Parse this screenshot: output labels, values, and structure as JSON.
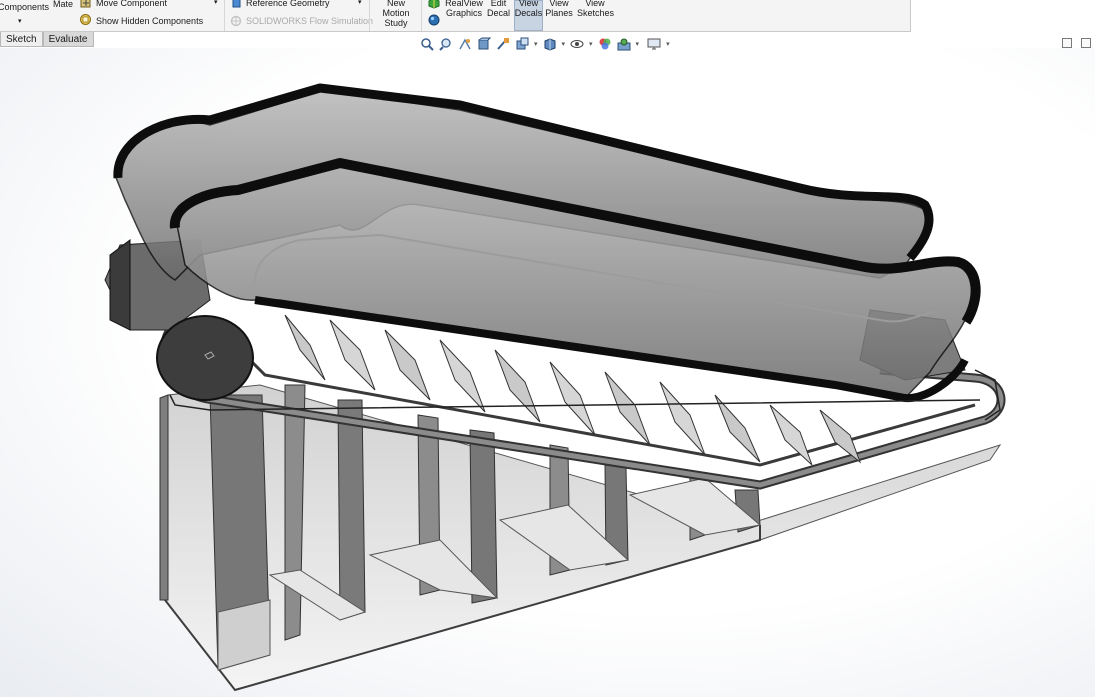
{
  "ribbon": {
    "insert_components_label": "Components",
    "mate_label": "Mate",
    "move_component_label": "Move Component",
    "show_hidden_label": "Show Hidden Components",
    "reference_geometry_label": "Reference Geometry",
    "flow_simulation_label": "SOLIDWORKS Flow Simulation",
    "new_motion_study_label": [
      "New",
      "Motion",
      "Study"
    ],
    "realview_label": [
      "RealView",
      "Graphics"
    ],
    "edit_decal_label": [
      "Edit",
      "Decal"
    ],
    "view_decals_label": [
      "View",
      "Decals"
    ],
    "view_planes_label": [
      "View",
      "Planes"
    ],
    "view_sketches_label": [
      "View",
      "Sketches"
    ]
  },
  "tabs": [
    {
      "label": "Sketch",
      "selected": false
    },
    {
      "label": "Evaluate",
      "selected": true
    }
  ],
  "heads_up_toolbar": {
    "icons": [
      "zoom-to-fit-icon",
      "zoom-to-area-icon",
      "previous-view-icon",
      "section-view-icon",
      "dynamic-annotation-icon",
      "view-orientation-icon",
      "display-style-icon",
      "hide-show-items-icon",
      "edit-appearance-icon",
      "apply-scene-icon",
      "view-settings-icon"
    ]
  },
  "colors": {
    "ribbon_bg": "#f4f4f4",
    "active_button_bg": "#c8d4e2",
    "model_dark": "#2a2a2a",
    "model_gray": "#8a8a8a",
    "glass": "#7c7c7c"
  }
}
